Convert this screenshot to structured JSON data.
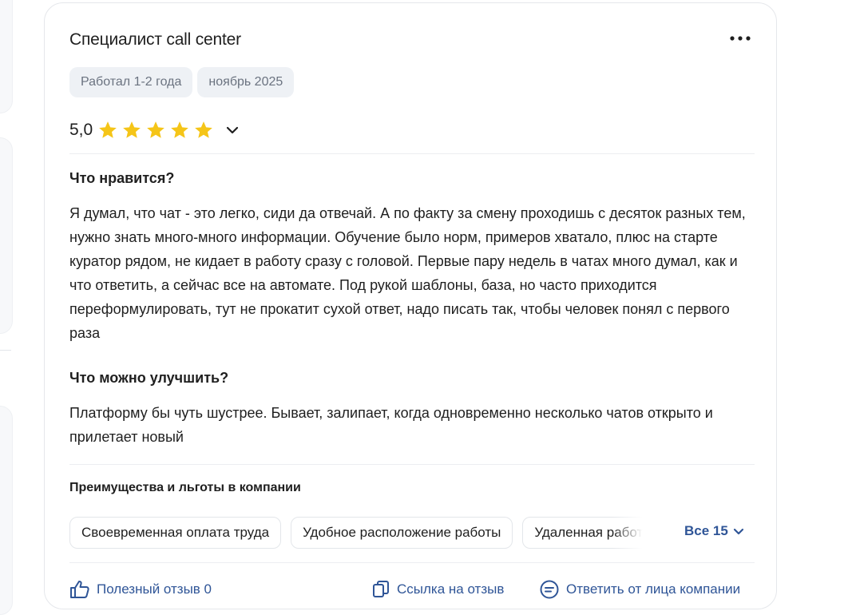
{
  "review": {
    "title": "Специалист call center",
    "tags": [
      "Работал 1-2 года",
      "ноябрь 2025"
    ],
    "rating": "5,0",
    "stars_filled": 5,
    "stars_total": 5,
    "likes_heading": "Что нравится?",
    "likes_text": "Я думал, что чат - это легко, сиди да отвечай. А по факту за смену проходишь с десяток разных тем, нужно знать много-много информации. Обучение было норм, примеров хватало, плюс на старте куратор рядом, не кидает в работу сразу с головой. Первые пару недель в чатах много думал, как и что ответить, а сейчас все на автомате. Под рукой шаблоны, база, но часто приходится переформулировать, тут не прокатит сухой ответ, надо писать так, чтобы человек понял с первого раза",
    "improve_heading": "Что можно улучшить?",
    "improve_text": "Платформу бы чуть шустрее. Бывает, залипает, когда одновременно несколько чатов открыто и прилетает новый"
  },
  "benefits": {
    "heading": "Преимущества и льготы в компании",
    "items": [
      "Своевременная оплата труда",
      "Удобное расположение работы",
      "Удаленная работа"
    ],
    "all_label": "Все 15"
  },
  "actions": {
    "helpful": "Полезный отзыв 0",
    "link": "Ссылка на отзыв",
    "reply": "Ответить от лица компании"
  },
  "colors": {
    "star": "#f5c518",
    "link": "#2f5597",
    "tag_bg": "#eef1f5",
    "tag_text": "#6b7380"
  },
  "icons": [
    "more-icon",
    "star-icon",
    "chevron-down-icon",
    "thumbs-up-icon",
    "copy-link-icon",
    "reply-icon"
  ]
}
